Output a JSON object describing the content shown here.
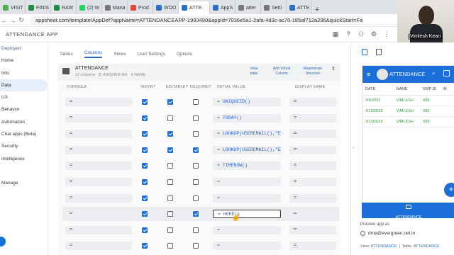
{
  "browser": {
    "tabs": [
      {
        "label": "VISIT",
        "color": "#4caf50"
      },
      {
        "label": "FINIS",
        "color": "#1e8e3e"
      },
      {
        "label": "RAW",
        "color": "#1e8e3e"
      },
      {
        "label": "(2) W",
        "color": "#25d366"
      },
      {
        "label": "Mana",
        "color": "#777777"
      },
      {
        "label": "Prod",
        "color": "#e8453c"
      },
      {
        "label": "WOO",
        "color": "#2c6fc9"
      },
      {
        "label": "ATTE",
        "color": "#2c6fc9",
        "active": true
      },
      {
        "label": "AppS",
        "color": "#2c6fc9"
      },
      {
        "label": "atter",
        "color": "#777777"
      },
      {
        "label": "Setti",
        "color": "#777777"
      },
      {
        "label": "ATTE",
        "color": "#2c6fc9"
      }
    ],
    "add_tab": "+",
    "url": "appsheet.com/template/AppDef?appName=ATTENDANCEAPP-1993490&appId=7036e5a1-2afa-4d3c-ac70-185af712a296&quickStart=Fals..."
  },
  "webcam": {
    "name": "Vimlesh Keari"
  },
  "app": {
    "title": "ATTENDANCE APP"
  },
  "sidebar": {
    "items": [
      "Deployed",
      "Home",
      "Info",
      "Data",
      "UX",
      "Behavior",
      "Automation",
      "Chat apps (Beta)",
      "Security",
      "Intelligence",
      "",
      "Manage"
    ],
    "active_index": 3
  },
  "subtabs": [
    "Tables",
    "Columns",
    "Slices",
    "User Settings",
    "Options"
  ],
  "subtabs_active_index": 1,
  "table": {
    "name": "ATTENDANCE",
    "columns_count": "12 columns",
    "key": "UNIQUER NO",
    "label": "NAME",
    "buttons": {
      "view": "View\ntable",
      "add": "Add Virtual\nColumn",
      "regen": "Regenerate\nStructure"
    },
    "headers": {
      "formula": "FORMULA",
      "show": "SHOW?",
      "editable": "EDITABLE?",
      "require": "REQUIRE?",
      "initial": "INITIAL VALUE",
      "display": "DISPLAY NAME"
    },
    "rows": [
      {
        "formula": "=",
        "show": true,
        "editable": true,
        "require": false,
        "initial": "= UNIQUEID()",
        "display": "="
      },
      {
        "formula": "=",
        "show": true,
        "editable": false,
        "require": false,
        "initial": "= TODAY()",
        "display": "="
      },
      {
        "formula": "=",
        "show": true,
        "editable": true,
        "require": false,
        "initial": "= LOOKUP(USEREMAIL(),\"E",
        "display": "="
      },
      {
        "formula": "=",
        "show": true,
        "editable": true,
        "require": true,
        "initial": "= LOOKUP(USEREMAIL(),\"E",
        "display": "="
      },
      {
        "formula": "=",
        "show": true,
        "editable": false,
        "require": false,
        "initial": "= TIMENOW()",
        "display": "="
      },
      {
        "formula": "=",
        "show": true,
        "editable": false,
        "require": false,
        "initial": "=",
        "display": "="
      },
      {
        "formula": "=",
        "show": true,
        "editable": false,
        "require": false,
        "initial": "=",
        "display": "="
      },
      {
        "formula": "=",
        "show": true,
        "editable": false,
        "require": true,
        "initial": "= HERE()",
        "display": "=",
        "focused": true
      },
      {
        "formula": "=",
        "show": true,
        "editable": false,
        "require": false,
        "initial": "=",
        "display": "="
      },
      {
        "formula": "=",
        "show": true,
        "editable": false,
        "require": false,
        "initial": "=",
        "display": "="
      }
    ]
  },
  "preview": {
    "app_title": "ATTENDANCE",
    "columns": [
      "DATE",
      "NAME",
      "EMP ID",
      "IN"
    ],
    "rows": [
      [
        "3/6/2023",
        "VIMLESH",
        "999",
        ""
      ],
      [
        "3/13/2023",
        "VIMLESH",
        "999",
        ""
      ],
      [
        "3/13/2023",
        "VIMLESH",
        "999",
        ""
      ]
    ],
    "nav_label": "ATTENDANCE",
    "fab": "+",
    "preview_as": "Preview app as",
    "email": "dme@evergreen.net.in",
    "view_label": "View:",
    "view_value": "ATTENDANCE",
    "table_label": "Table:",
    "table_value": "ATTENDANCE"
  },
  "colors": {
    "accent": "#1b6fd8",
    "green": "#2e9a3c"
  }
}
